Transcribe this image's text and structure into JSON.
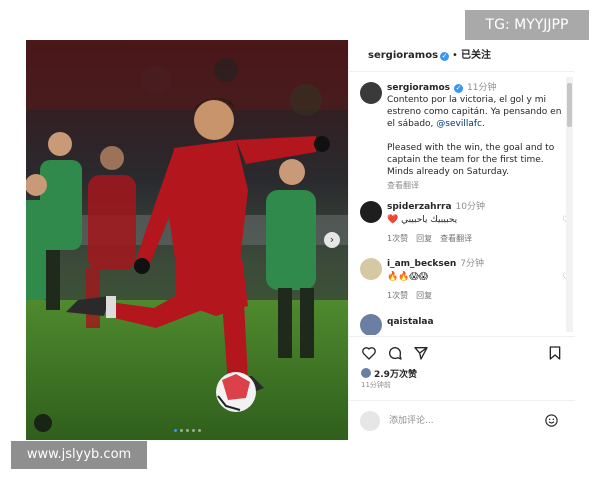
{
  "watermarks": {
    "tg": "TG: MYYJJPP",
    "site": "www.jslyyb.com"
  },
  "post": {
    "carousel": {
      "slide_count": 5,
      "active_slide": 1,
      "next_icon": "chevron-right-icon"
    },
    "header": {
      "username": "sergioramos",
      "separator": "•",
      "follow_state": "已关注"
    },
    "caption": {
      "username": "sergioramos",
      "time": "11分钟",
      "spanish": "Contento por la victoria, el gol y mi estreno como capitán. Ya pensando en el sábado, ",
      "mention": "@sevillafc",
      "spanish_end": ".",
      "english": "Pleased with the win, the goal and to captain the team for the first time. Minds already on Saturday.",
      "see_translation": "查看翻译"
    },
    "comments": [
      {
        "username": "spiderzahrra",
        "time": "10分钟",
        "text": "❤️ يحبيبيك ياحبيبي",
        "likes": "1次赞",
        "reply": "回复",
        "translate": "查看翻译"
      },
      {
        "username": "i_am_becksen",
        "time": "7分钟",
        "text": "🔥🔥😱😱",
        "likes": "1次赞",
        "reply": "回复"
      },
      {
        "username": "qaistalaa"
      }
    ],
    "likes_label": "2.9万次赞",
    "posted_ago": "11分钟前",
    "composer_placeholder": "添加评论...",
    "colors": {
      "accent": "#3897f0",
      "jersey_red": "#b3161d",
      "opponent_green": "#2f8a4c"
    }
  }
}
